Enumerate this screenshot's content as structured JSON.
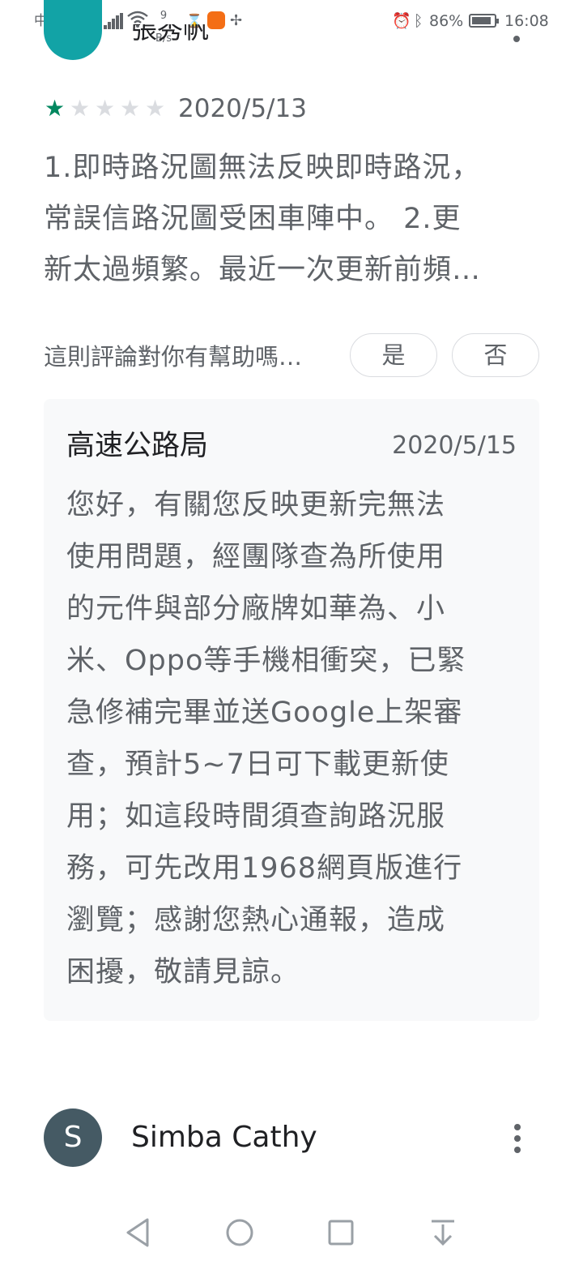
{
  "status_bar": {
    "carrier": "中華電信",
    "speed_value": "9",
    "speed_unit": "B/s",
    "battery": "86%",
    "time": "16:08"
  },
  "previous_review": {
    "author_partial": "張秀帆"
  },
  "review": {
    "rating": 1,
    "max_rating": 5,
    "date": "2020/5/13",
    "text_lines": [
      "1.即時路況圖無法反映即時路況，",
      "常誤信路況圖受困車陣中。 2.更",
      "新太過頻繁。最近一次更新前頻…"
    ],
    "helpful_question": "這則評論對你有幫助嗎…",
    "yes_label": "是",
    "no_label": "否"
  },
  "developer_reply": {
    "developer": "高速公路局",
    "date": "2020/5/15",
    "text_lines": [
      "您好，有關您反映更新完無法",
      "使用問題，經團隊查為所使用",
      "的元件與部分廠牌如華為、小",
      "米、Oppo等手機相衝突，已緊",
      "急修補完畢並送Google上架審",
      "查，預計5~7日可下載更新使",
      "用；如這段時間須查詢路況服",
      "務，可先改用1968網頁版進行",
      "瀏覽；感謝您熱心通報，造成",
      "困擾，敬請見諒。"
    ]
  },
  "next_review": {
    "avatar_letter": "S",
    "author": "Simba Cathy"
  },
  "colors": {
    "star_active": "#01875f",
    "star_inactive": "#dadce0",
    "reply_background": "#f8f9fa",
    "avatar_next": "#455a64",
    "avatar_previous": "#12a3a6"
  }
}
